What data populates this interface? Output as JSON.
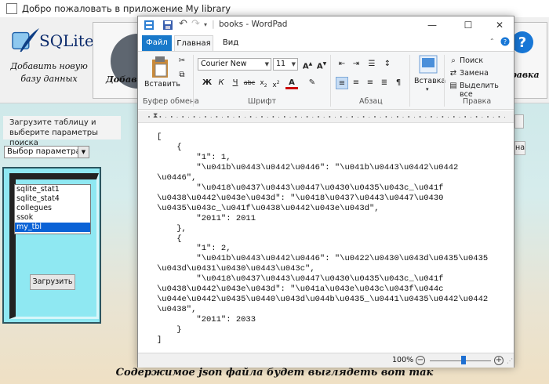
{
  "app": {
    "title": "Добро пожаловать в приложение My library",
    "logo_text": "SQLite",
    "logo_caption_1": "Добавить новую",
    "logo_caption_2": "базу данных",
    "tile_left_label": "Добави",
    "tile_right_label": "равка",
    "panel_label_1": "Загрузите таблицу и",
    "panel_label_2": "выберите параметры поиска",
    "combo_value": "Выбор параметра",
    "list_items": [
      "sqlite_stat1",
      "sqlite_stat4",
      "collegues",
      "ssok",
      "my_tbl"
    ],
    "selected_item": "my_tbl",
    "load_button": "Загрузить",
    "right_stub_text": "на",
    "bottom_caption": "Содержимое json файла будет выглядеть вот так"
  },
  "wordpad": {
    "title": "books - WordPad",
    "tabs": {
      "file": "Файл",
      "home": "Главная",
      "view": "Вид"
    },
    "paste_label": "Вставить",
    "clipboard_group": "Буфер обмена",
    "font_name": "Courier New",
    "font_size": "11",
    "font_group": "Шрифт",
    "paragraph_group": "Абзац",
    "insert_label": "Вставка",
    "find_label": "Поиск",
    "replace_label": "Замена",
    "select_all_label": "Выделить все",
    "editing_group": "Правка",
    "document_lines": [
      "[",
      "    {",
      "        \"1\": 1,",
      "        \"\\u041b\\u0443\\u0442\\u0446\": \"\\u041b\\u0443\\u0442\\u0442",
      "\\u0446\",",
      "        \"\\u0418\\u0437\\u0443\\u0447\\u0430\\u0435\\u043c_\\u041f",
      "\\u0438\\u0442\\u043e\\u043d\": \"\\u0418\\u0437\\u0443\\u0447\\u0430",
      "\\u0435\\u043c_\\u041f\\u0438\\u0442\\u043e\\u043d\",",
      "        \"2011\": 2011",
      "    },",
      "    {",
      "        \"1\": 2,",
      "        \"\\u041b\\u0443\\u0442\\u0446\": \"\\u0422\\u0430\\u043d\\u0435\\u0435",
      "\\u043d\\u0431\\u0430\\u0443\\u043c\",",
      "        \"\\u0418\\u0437\\u0443\\u0447\\u0430\\u0435\\u043c_\\u041f",
      "\\u0438\\u0442\\u043e\\u043d\": \"\\u041a\\u043e\\u043c\\u043f\\u044c",
      "\\u044e\\u0442\\u0435\\u0440\\u043d\\u044b\\u0435_\\u0441\\u0435\\u0442\\u0442",
      "\\u0438\",",
      "        \"2011\": 2033",
      "    }",
      "]"
    ],
    "zoom_level": "100%",
    "zoom_fraction": 0.55
  }
}
